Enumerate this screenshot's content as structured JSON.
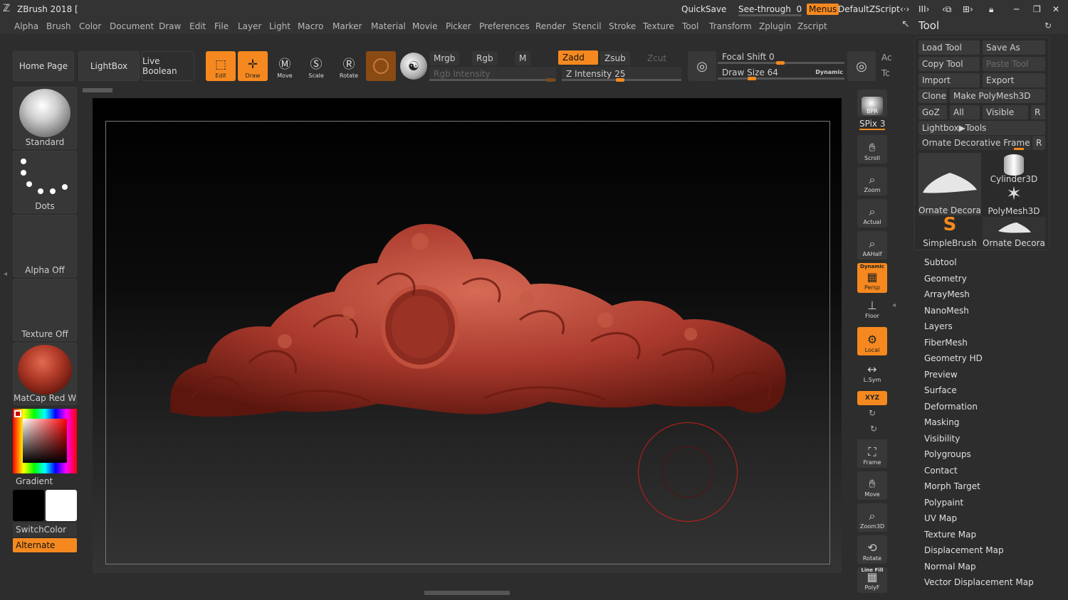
{
  "app": {
    "title": "ZBrush 2018 [",
    "quicksave": "QuickSave",
    "see_through": "See-through",
    "see_through_value": "0",
    "menus": "Menus",
    "script": "DefaultZScript"
  },
  "menubar": [
    "Alpha",
    "Brush",
    "Color",
    "Document",
    "Draw",
    "Edit",
    "File",
    "Layer",
    "Light",
    "Macro",
    "Marker",
    "Material",
    "Movie",
    "Picker",
    "Preferences",
    "Render",
    "Stencil",
    "Stroke",
    "Texture",
    "Tool",
    "Transform",
    "Zplugin",
    "Zscript"
  ],
  "toolbar": {
    "home": "Home Page",
    "lightbox": "LightBox",
    "live_boolean": "Live Boolean",
    "edit": "Edit",
    "draw": "Draw",
    "move": "Move",
    "scale": "Scale",
    "rotate": "Rotate",
    "mrgb": "Mrgb",
    "rgb": "Rgb",
    "m": "M",
    "zadd": "Zadd",
    "zsub": "Zsub",
    "zcut": "Zcut",
    "rgb_intensity": "Rgb Intensity",
    "z_intensity": "Z Intensity 25",
    "z_intensity_level": 0.25,
    "focal_shift": "Focal Shift 0",
    "draw_size": "Draw Size 64",
    "dynamic": "Dynamic",
    "ac": "Ac",
    "tc": "Tc"
  },
  "left_shelf": {
    "brush": "Standard",
    "stroke": "Dots",
    "alpha": "Alpha Off",
    "texture": "Texture Off",
    "material": "MatCap Red Wax",
    "gradient": "Gradient",
    "switchcolor": "SwitchColor",
    "alternate": "Alternate"
  },
  "right_bar": {
    "bpr": "BPR",
    "spix": "SPix 3",
    "scroll": "Scroll",
    "zoom": "Zoom",
    "actual": "Actual",
    "aahalf": "AAHalf",
    "dynamic": "Dynamic",
    "persp": "Persp",
    "floor": "Floor",
    "local": "Local",
    "lsym": "L.Sym",
    "xyz": "XYZ",
    "frame": "Frame",
    "move": "Move",
    "zoom3d": "Zoom3D",
    "rotate": "Rotate",
    "linefill": "Line Fill",
    "polyf": "PolyF"
  },
  "tool_panel": {
    "title": "Tool",
    "load_tool": "Load Tool",
    "save_as": "Save As",
    "copy_tool": "Copy Tool",
    "paste_tool": "Paste Tool",
    "import": "Import",
    "export": "Export",
    "clone": "Clone",
    "make_polymesh": "Make PolyMesh3D",
    "goz": "GoZ",
    "all": "All",
    "visible": "Visible",
    "r": "R",
    "lightbox_tools": "Lightbox▶Tools",
    "current_tool": "Ornate Decorative Frame Bas",
    "thumbs": [
      "Ornate Decorati",
      "Cylinder3D",
      "PolyMesh3D",
      "SimpleBrush",
      "Ornate Decorati"
    ]
  },
  "subpalettes": [
    "Subtool",
    "Geometry",
    "ArrayMesh",
    "NanoMesh",
    "Layers",
    "FiberMesh",
    "Geometry HD",
    "Preview",
    "Surface",
    "Deformation",
    "Masking",
    "Visibility",
    "Polygroups",
    "Contact",
    "Morph Target",
    "Polypaint",
    "UV Map",
    "Texture Map",
    "Displacement Map",
    "Normal Map",
    "Vector Displacement Map"
  ],
  "colors": {
    "accent": "#f5891f",
    "model": "#a8382c",
    "cursor_ring": "#c0201a"
  }
}
